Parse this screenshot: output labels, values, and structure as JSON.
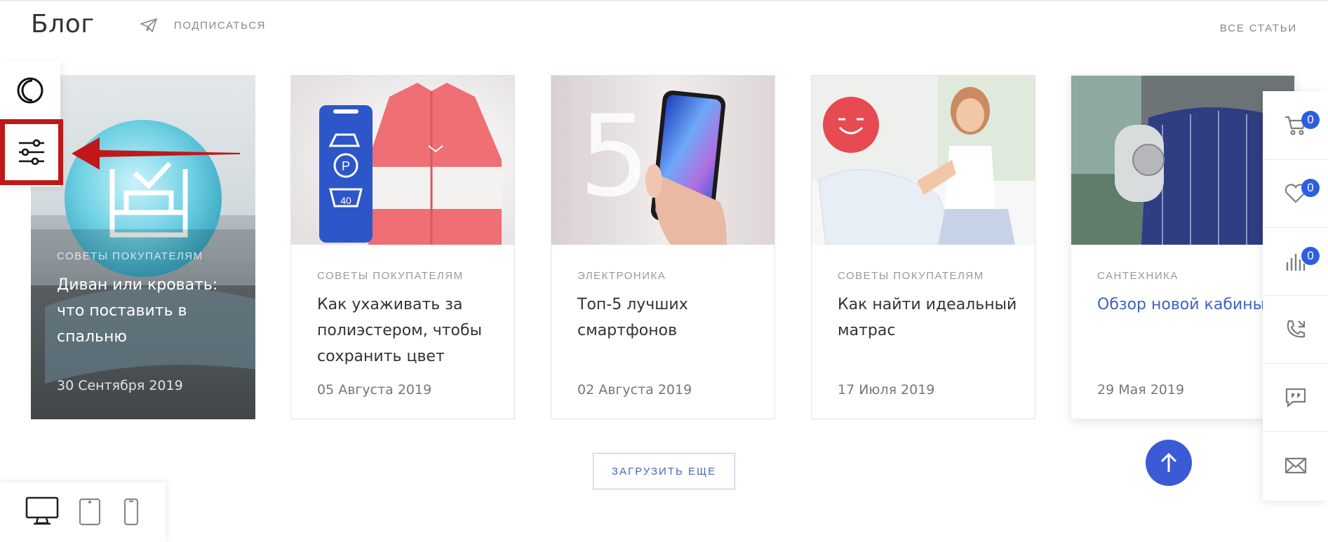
{
  "header": {
    "title": "Блог",
    "subscribe_label": "ПОДПИСАТЬСЯ",
    "all_articles_label": "ВСЕ СТАТЬИ"
  },
  "cards": [
    {
      "category": "СОВЕТЫ ПОКУПАТЕЛЯМ",
      "title": "Диван или кровать: что поставить в спальню",
      "date": "30 Сентября 2019"
    },
    {
      "category": "СОВЕТЫ ПОКУПАТЕЛЯМ",
      "title": "Как ухаживать за полиэстером, чтобы сохранить цвет",
      "date": "05 Августа 2019"
    },
    {
      "category": "ЭЛЕКТРОНИКА",
      "title": "Топ-5 лучших смартфонов",
      "date": "02 Августа 2019"
    },
    {
      "category": "СОВЕТЫ ПОКУПАТЕЛЯМ",
      "title": "Как найти идеальный матрас",
      "date": "17 Июля 2019"
    },
    {
      "category": "САНТЕХНИКА",
      "title": "Обзор новой кабины для душа или зачем нужен гидромассаж",
      "date": "29 Мая 2019"
    }
  ],
  "load_more_label": "ЗАГРУЗИТЬ ЕЩЕ",
  "right_panel": {
    "cart_count": "0",
    "favorites_count": "0",
    "compare_count": "0",
    "icons": [
      "cart-icon",
      "heart-icon",
      "compare-icon",
      "phone-callback-icon",
      "chat-quote-icon",
      "mail-icon"
    ]
  },
  "image_text": {
    "washing_temp": "40",
    "parking_letter": "P",
    "big_number": "5"
  },
  "colors": {
    "accent": "#3b5bd6",
    "badge": "#2c5fe0",
    "highlight_border": "#c01818",
    "link_title": "#3e62c4"
  }
}
